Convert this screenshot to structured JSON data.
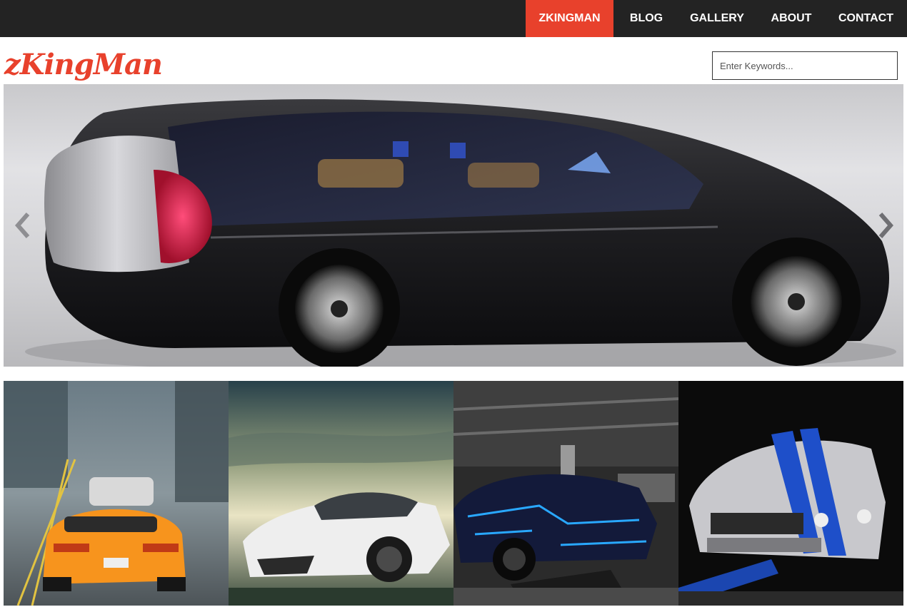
{
  "nav": {
    "items": [
      {
        "label": "ZKINGMAN",
        "active": true
      },
      {
        "label": "BLOG",
        "active": false
      },
      {
        "label": "GALLERY",
        "active": false
      },
      {
        "label": "ABOUT",
        "active": false
      },
      {
        "label": "CONTACT",
        "active": false
      }
    ]
  },
  "header": {
    "logo_text": "zKingMan",
    "search_placeholder": "Enter Keywords..."
  },
  "hero": {
    "prev_icon": "chevron-left-icon",
    "next_icon": "chevron-right-icon"
  },
  "gallery": {
    "tiles": [
      {
        "subject": "orange sports car on city street"
      },
      {
        "subject": "white lamborghini under cloudy sky"
      },
      {
        "subject": "dark car with neon blue lights in garage"
      },
      {
        "subject": "silver mustang with blue racing stripes"
      }
    ]
  },
  "colors": {
    "accent": "#e8412c",
    "topbar": "#232323"
  }
}
